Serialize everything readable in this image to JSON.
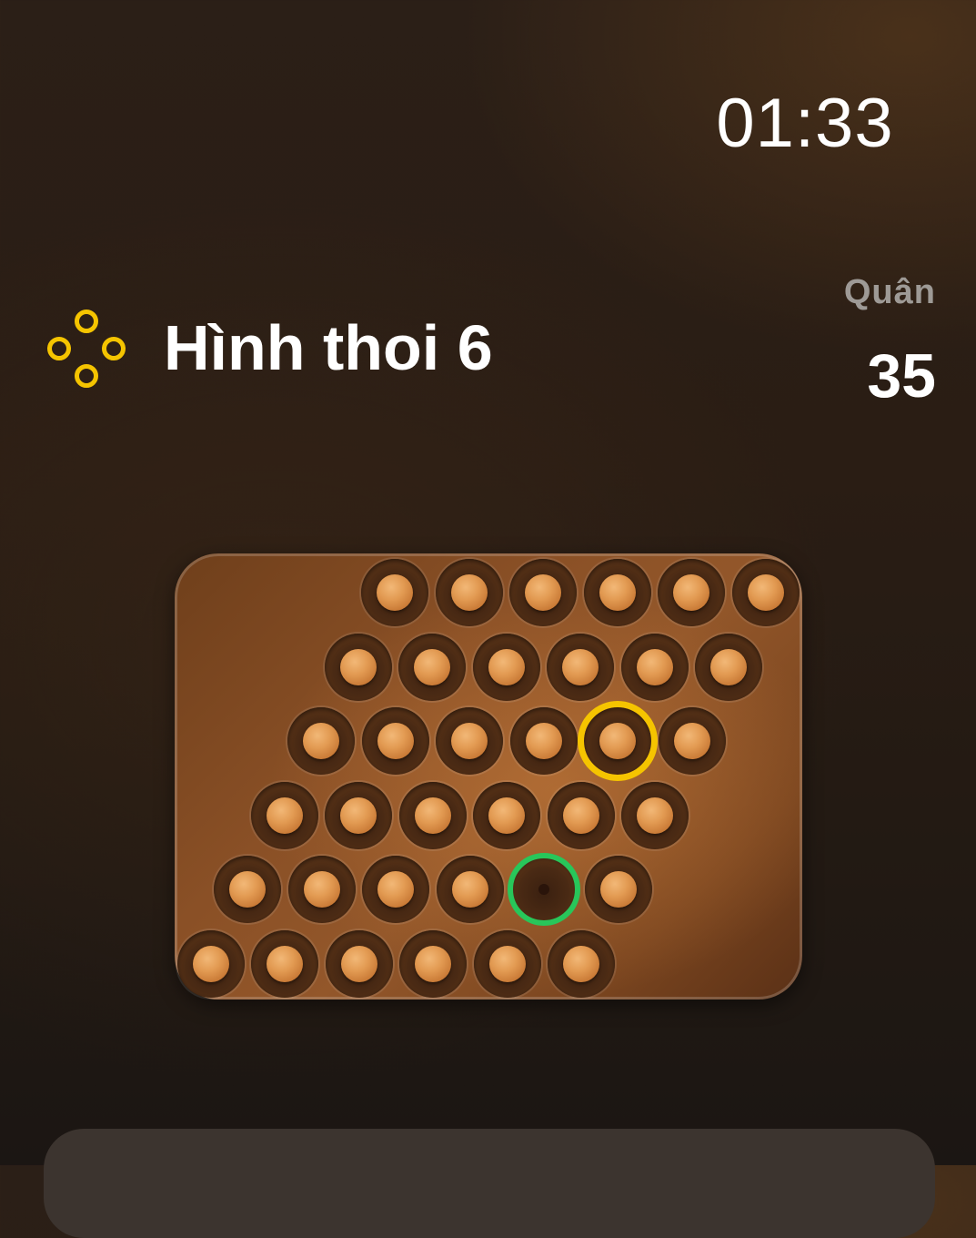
{
  "status": {
    "time": "01:33"
  },
  "level": {
    "icon": "diamond-rings-icon",
    "title": "Hình thoi 6"
  },
  "pieces": {
    "label": "Quân",
    "count": "35"
  },
  "colors": {
    "selected_ring": "#f5c400",
    "target_ring": "#28c65a",
    "peg": "#e29a52",
    "board": "#8a5026"
  },
  "board": {
    "rows": [
      [
        "peg",
        "peg",
        "peg",
        "peg",
        "peg",
        "peg"
      ],
      [
        "peg",
        "peg",
        "peg",
        "peg",
        "peg",
        "peg"
      ],
      [
        "peg",
        "peg",
        "peg",
        "peg",
        "peg",
        "peg"
      ],
      [
        "peg",
        "peg",
        "peg",
        "peg",
        "peg",
        "peg"
      ],
      [
        "peg",
        "peg",
        "peg",
        "peg",
        "empty",
        "peg"
      ],
      [
        "peg",
        "peg",
        "peg",
        "peg",
        "peg",
        "peg"
      ]
    ],
    "selected": {
      "row": 2,
      "col": 4
    },
    "target": {
      "row": 4,
      "col": 4
    }
  }
}
